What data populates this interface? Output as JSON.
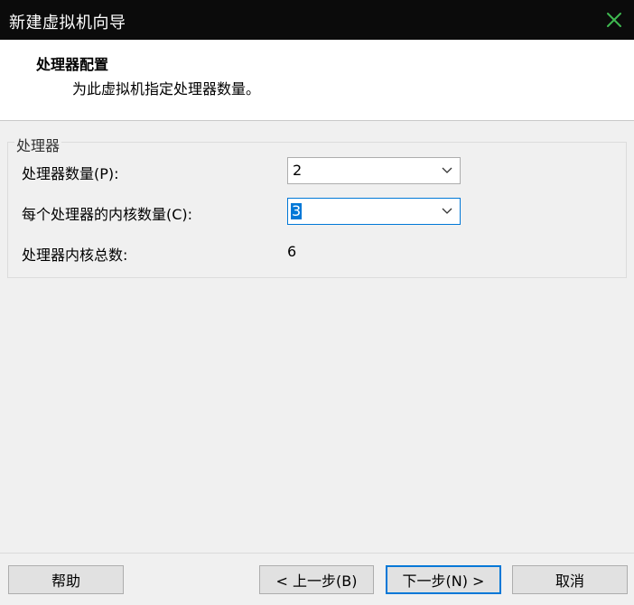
{
  "window": {
    "title": "新建虚拟机向导",
    "close_icon": "close-icon",
    "close_color": "#3fb950"
  },
  "header": {
    "title": "处理器配置",
    "subtitle": "为此虚拟机指定处理器数量。"
  },
  "processor_group": {
    "legend": "处理器",
    "processor_count_label": "处理器数量(P):",
    "processor_count_value": "2",
    "cores_label": "每个处理器的内核数量(C):",
    "cores_value": "3",
    "total_label": "处理器内核总数:",
    "total_value": "6"
  },
  "footer": {
    "help": "帮助",
    "back": "< 上一步(B)",
    "next": "下一步(N) >",
    "cancel": "取消"
  }
}
